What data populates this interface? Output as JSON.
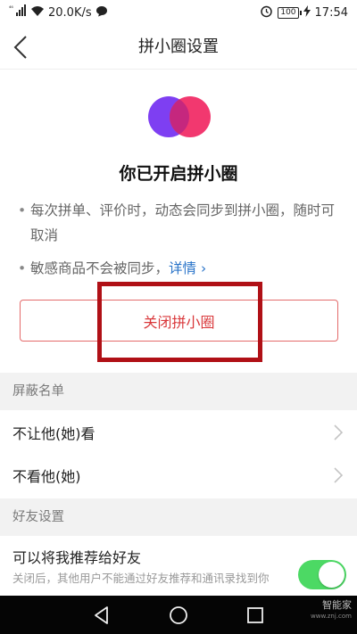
{
  "status_bar": {
    "signal": "⁴⁶",
    "speed": "20.0K/s",
    "battery": "100",
    "time": "17:54"
  },
  "header": {
    "title": "拼小圈设置"
  },
  "hero": {
    "title": "你已开启拼小圈",
    "bullet1": "每次拼单、评价时，动态会同步到拼小圈，随时可取消",
    "bullet2": "敏感商品不会被同步，",
    "detail_link": "详情 ›"
  },
  "close_button": {
    "label": "关闭拼小圈"
  },
  "blacklist": {
    "header": "屏蔽名单",
    "items": [
      {
        "label": "不让他(她)看"
      },
      {
        "label": "不看他(她)"
      }
    ]
  },
  "friend_settings": {
    "header": "好友设置",
    "recommend_title": "可以将我推荐给好友",
    "recommend_desc": "关闭后，其他用户不能通过好友推荐和通讯录找到你",
    "toggle_on": true
  },
  "watermark": {
    "text": "智能家",
    "url": "www.znj.com"
  },
  "colors": {
    "accent_red": "#d9373a",
    "link_blue": "#2a74c9",
    "toggle_green": "#4cd964",
    "annotation": "#b01016"
  }
}
